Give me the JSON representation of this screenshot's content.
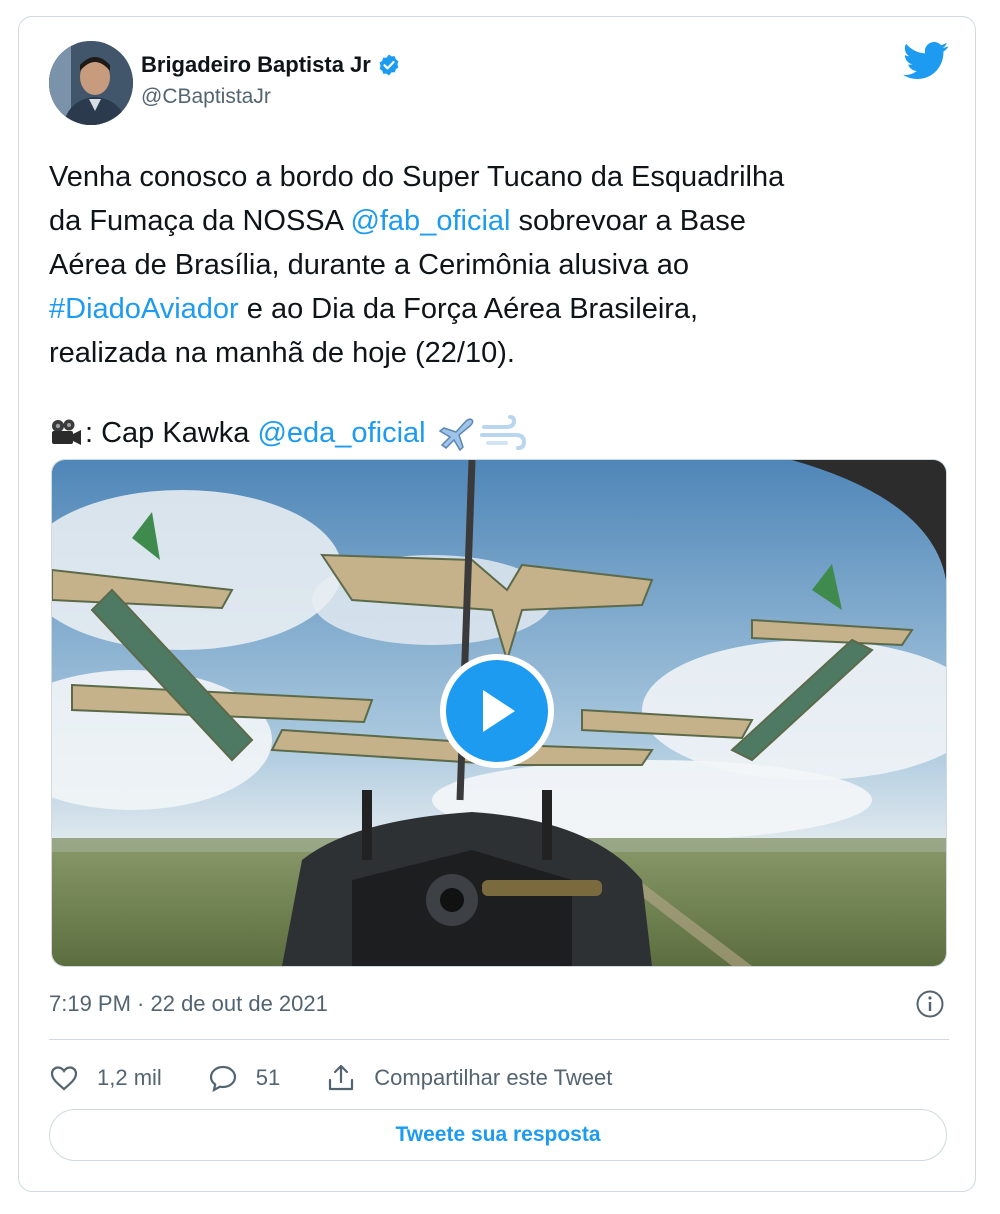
{
  "author": {
    "name": "Brigadeiro Baptista Jr",
    "handle": "@CBaptistaJr",
    "verified": true,
    "avatar_icon": "profile-photo"
  },
  "brand": {
    "icon": "twitter-bird-icon",
    "color": "#1d9bf0"
  },
  "tweet": {
    "segments": [
      {
        "text": "Venha conosco a bordo do Super Tucano da Esquadrilha\nda Fumaça da NOSSA ",
        "link": false
      },
      {
        "text": "@fab_oficial",
        "link": true
      },
      {
        "text": " sobrevoar a Base\nAérea de Brasília, durante a Cerimônia alusiva ao\n",
        "link": false
      },
      {
        "text": "#DiadoAviador",
        "link": true
      },
      {
        "text": " e ao Dia da Força Aérea Brasileira,\nrealizada na manhã de hoje (22/10).",
        "link": false
      }
    ],
    "credit": {
      "prefix": ": Cap Kawka ",
      "mention": "@eda_oficial",
      "emojis": [
        "movie-camera-icon",
        "airplane-icon",
        "dash-icon"
      ]
    }
  },
  "media": {
    "type": "video",
    "play_icon": "play-icon"
  },
  "meta": {
    "timestamp": "7:19 PM · 22 de out de 2021",
    "info_icon": "info-icon"
  },
  "actions": {
    "likes": "1,2 mil",
    "replies": "51",
    "share_label": "Compartilhar este Tweet"
  },
  "reply_button": "Tweete sua resposta",
  "colors": {
    "text": "#0f1419",
    "secondary": "#536471",
    "link": "#1d9bf0",
    "border": "#cfd9de"
  }
}
